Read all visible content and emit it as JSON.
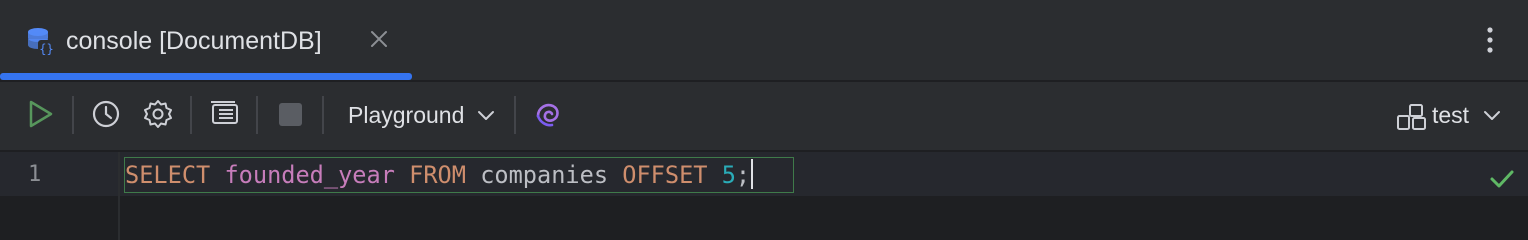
{
  "tab": {
    "title": "console [DocumentDB]",
    "icon": "database-console-icon"
  },
  "toolbar": {
    "run_icon": "run-icon",
    "history_icon": "history-icon",
    "settings_icon": "settings-icon",
    "output_icon": "output-layout-icon",
    "stop_icon": "stop-icon",
    "mode": "Playground",
    "ai_icon": "ai-assistant-icon",
    "datasource": "test"
  },
  "editor": {
    "line_number": "1",
    "tokens": {
      "t1": "SELECT",
      "t2": "founded_year",
      "t3": "FROM",
      "t4": "companies",
      "t5": "OFFSET",
      "t6": "5",
      "t7": ";"
    }
  },
  "colors": {
    "accent": "#3574f0",
    "run": "#57965c",
    "keyword": "#cf8e6d",
    "column": "#c77dbb",
    "number": "#2aacb8",
    "check": "#5fb865"
  }
}
